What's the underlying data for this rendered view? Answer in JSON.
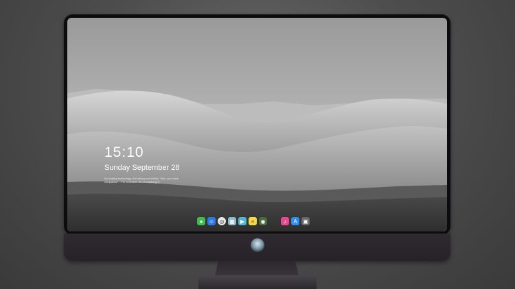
{
  "lockscreen": {
    "time": "15:10",
    "date": "Sunday September 28",
    "tagline": "Innovating technology, Elevating productivity, \"Mac your ideal companion\" - For a smarter life, Everything[?]"
  },
  "dock": {
    "apps": [
      {
        "name": "messages-icon",
        "color": "#3fbf4a"
      },
      {
        "name": "finder-icon",
        "color": "#2c7be5"
      },
      {
        "name": "safari-icon",
        "color": "#e8e8e8"
      },
      {
        "name": "preview-icon",
        "color": "#8fb9c9"
      },
      {
        "name": "final-cut-icon",
        "color": "#4fb6d6"
      },
      {
        "name": "notes-icon",
        "color": "#f5d84a"
      },
      {
        "name": "photo-booth-icon",
        "color": "#4c6a3c"
      },
      {
        "name": "music-icon",
        "color": "#e54a8e"
      },
      {
        "name": "app-store-icon",
        "color": "#2f8df0"
      },
      {
        "name": "photo-icon",
        "color": "#6a6a6e"
      }
    ]
  },
  "colors": {
    "background": "#4e4e4e",
    "bezel": "#0c0c0e",
    "chin": "#2a262b"
  }
}
